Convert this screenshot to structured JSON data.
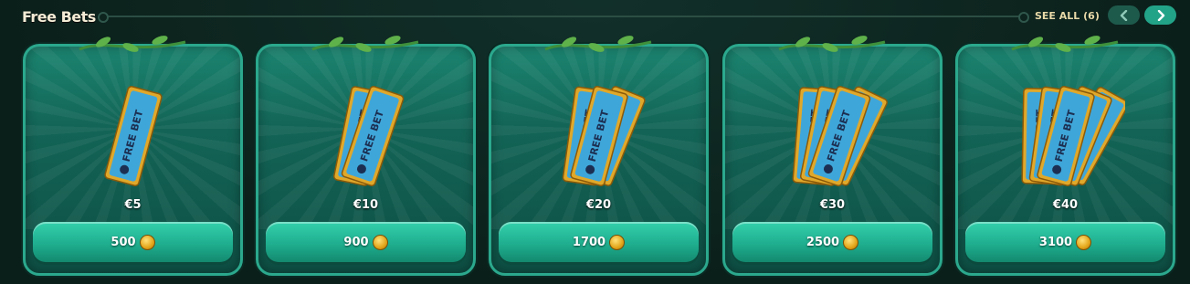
{
  "header": {
    "title": "Free Bets",
    "see_all": "SEE ALL (6)"
  },
  "colors": {
    "accent": "#22a388",
    "card_border": "#2ba88d",
    "title": "#f5ecd6",
    "see_all": "#e8d9a8",
    "ticket_blue": "#3fa6d9",
    "ticket_gold": "#e0a82a"
  },
  "icons": {
    "prev": "chevron-left-icon",
    "next": "chevron-right-icon",
    "coin": "coin-icon",
    "ticket": "free-bet-ticket-icon"
  },
  "cards": [
    {
      "price": "€5",
      "cost": "500",
      "tickets": 1
    },
    {
      "price": "€10",
      "cost": "900",
      "tickets": 2
    },
    {
      "price": "€20",
      "cost": "1700",
      "tickets": 3
    },
    {
      "price": "€30",
      "cost": "2500",
      "tickets": 4
    },
    {
      "price": "€40",
      "cost": "3100",
      "tickets": 5
    }
  ],
  "ticket_text": "FREE BET"
}
